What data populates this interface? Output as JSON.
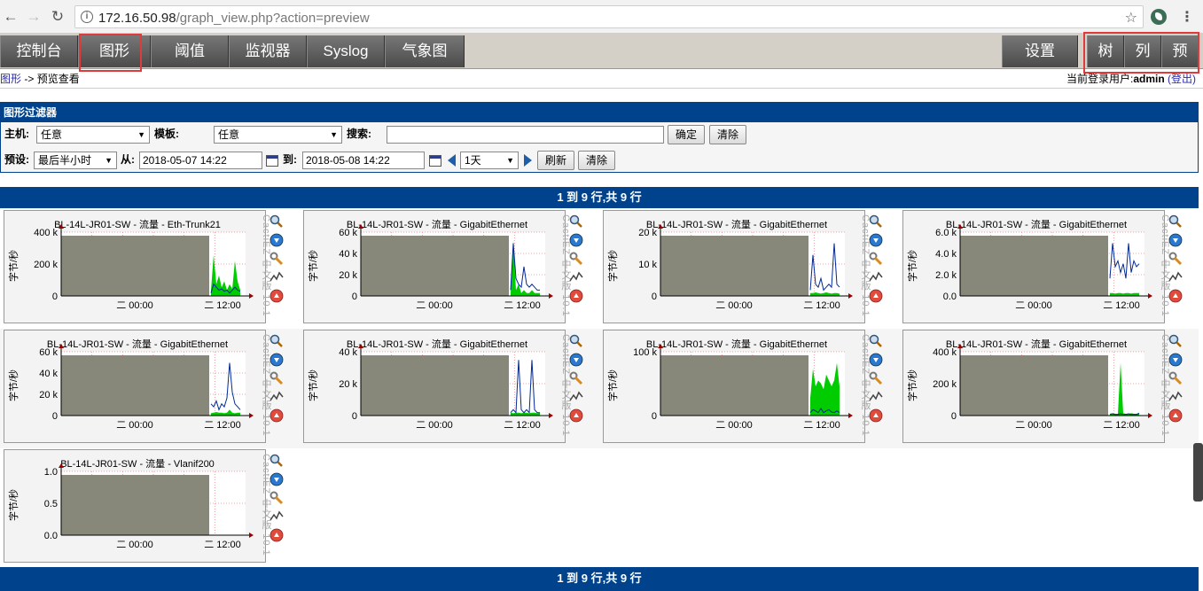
{
  "browser": {
    "url_host": "172.16.50.98",
    "url_path": "/graph_view.php?action=preview"
  },
  "tabs": [
    "控制台",
    "图形",
    "阈值",
    "监视器",
    "Syslog",
    "气象图"
  ],
  "right_tabs": [
    "设置",
    "树",
    "列",
    "预"
  ],
  "breadcrumb": {
    "link": "图形",
    "separator": "->",
    "current": "预览查看",
    "user_prefix": "当前登录用户:",
    "user": "admin",
    "logout": "(登出)"
  },
  "filter": {
    "title": "图形过滤器",
    "host_label": "主机:",
    "host_value": "任意",
    "template_label": "模板:",
    "template_value": "任意",
    "search_label": "搜索:",
    "search_value": "",
    "ok_button": "确定",
    "clear_button": "清除",
    "preset_label": "预设:",
    "preset_value": "最后半小时",
    "from_label": "从:",
    "from_value": "2018-05-07 14:22",
    "to_label": "到:",
    "to_value": "2018-05-08 14:22",
    "span_value": "1天",
    "refresh_button": "刷新",
    "clear2_button": "清除"
  },
  "pagination": "1 到 9 行,共 9 行",
  "graph_common": {
    "ylabel": "字节/秒",
    "watermark": "CactiEZ 中文版 10.1",
    "xticks": [
      "二 00:00",
      "二 12:00"
    ]
  },
  "graphs": [
    {
      "title": "BL-14L-JR01-SW - 流量 - Eth-Trunk21",
      "yticks": [
        "400 k",
        "200 k",
        "0"
      ],
      "variant": 0
    },
    {
      "title": "BL-14L-JR01-SW - 流量 - GigabitEthernet",
      "yticks": [
        "60 k",
        "40 k",
        "20 k",
        "0"
      ],
      "variant": 1
    },
    {
      "title": "BL-14L-JR01-SW - 流量 - GigabitEthernet",
      "yticks": [
        "20 k",
        "10 k",
        "0"
      ],
      "variant": 2
    },
    {
      "title": "BL-14L-JR01-SW - 流量 - GigabitEthernet",
      "yticks": [
        "6.0 k",
        "4.0 k",
        "2.0 k",
        "0.0"
      ],
      "variant": 3
    },
    {
      "title": "BL-14L-JR01-SW - 流量 - GigabitEthernet",
      "yticks": [
        "60 k",
        "40 k",
        "20 k",
        "0"
      ],
      "variant": 4
    },
    {
      "title": "BL-14L-JR01-SW - 流量 - GigabitEthernet",
      "yticks": [
        "40 k",
        "20 k",
        "0"
      ],
      "variant": 5
    },
    {
      "title": "BL-14L-JR01-SW - 流量 - GigabitEthernet",
      "yticks": [
        "100 k",
        "0"
      ],
      "variant": 6
    },
    {
      "title": "BL-14L-JR01-SW - 流量 - GigabitEthernet",
      "yticks": [
        "400 k",
        "200 k",
        "0"
      ],
      "variant": 7
    },
    {
      "title": "BL-14L-JR01-SW - 流量 - Vlanif200",
      "yticks": [
        "1.0",
        "0.5",
        "0.0"
      ],
      "variant": 8
    }
  ],
  "graph_actions": [
    "zoom-icon",
    "download-icon",
    "edit-icon",
    "trend-icon",
    "up-icon"
  ],
  "colors": {
    "header_blue": "#00438c",
    "highlight_red": "#e03b3b",
    "plot_gray": "#87877a",
    "traffic_in": "#00cc00",
    "traffic_out": "#002a97"
  }
}
